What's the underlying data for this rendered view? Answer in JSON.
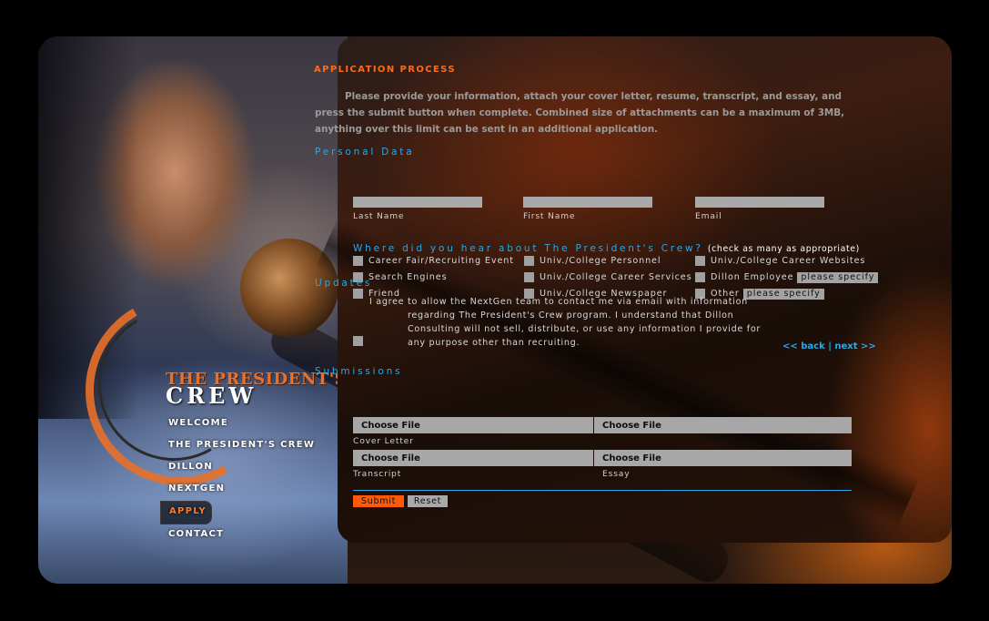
{
  "colors": {
    "accent_orange": "#ff6a1a",
    "section_blue": "#2aa8e8",
    "input_gray": "#a9a9a9"
  },
  "logo": {
    "line1": "THE PRESIDENT'S",
    "line2": "CREW"
  },
  "nav": [
    {
      "label": "WELCOME",
      "active": false
    },
    {
      "label": "THE PRESIDENT'S CREW",
      "active": false
    },
    {
      "label": "DILLON",
      "active": false
    },
    {
      "label": "NEXTGEN",
      "active": false
    },
    {
      "label": "APPLY",
      "active": true
    },
    {
      "label": "CONTACT",
      "active": false
    }
  ],
  "form": {
    "title": "APPLICATION PROCESS",
    "intro": "Please provide your information, attach your cover letter, resume, transcript, and essay, and press the submit button when complete. Combined size of attachments can be a maximum of 3MB, anything over this limit can be sent in an additional application.",
    "personal": {
      "heading": "Personal Data",
      "fields": [
        {
          "label": "Last Name",
          "value": ""
        },
        {
          "label": "First Name",
          "value": ""
        },
        {
          "label": "Email",
          "value": ""
        }
      ]
    },
    "hear": {
      "heading": "Where did you hear about The President's Crew?",
      "note": "(check as many as appropriate)",
      "col1": [
        "Career Fair/Recruiting Event",
        "Search Engines",
        "Friend"
      ],
      "col2": [
        "Univ./College Personnel",
        "Univ./College Career Services",
        "Univ./College Newspaper"
      ],
      "col3": [
        "Univ./College Career Websites",
        "Dillon Employee",
        "Other"
      ],
      "specify_placeholder": "please specify"
    },
    "updates": {
      "heading": "Updates",
      "text": "I agree to allow the NextGen team to contact me via email with information regarding The President's Crew program. I understand that Dillon Consulting will not sell, distribute, or use any information I provide for any purpose other than recruiting."
    },
    "pager": {
      "back": "<< back",
      "sep": "|",
      "next": "next >>"
    },
    "submissions": {
      "heading": "Submissions",
      "choose_label": "Choose File",
      "files": [
        "Cover Letter",
        "Transcript",
        "Essay"
      ],
      "resume_label": ""
    },
    "buttons": {
      "submit": "Submit",
      "reset": "Reset"
    }
  }
}
